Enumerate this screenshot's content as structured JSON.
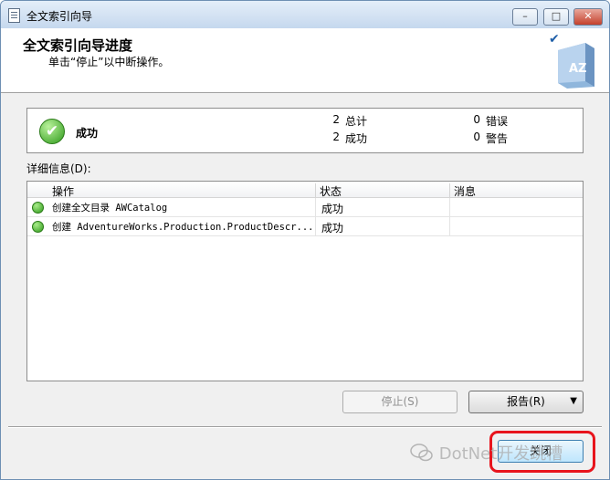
{
  "window": {
    "title": "全文索引向导",
    "controls": {
      "minimize": "–",
      "maximize": "□",
      "close": "✕"
    }
  },
  "header": {
    "title": "全文索引向导进度",
    "subtitle": "单击“停止”以中断操作。",
    "book_icon_text": "AZ",
    "check_mark": "✔"
  },
  "status": {
    "result": "成功",
    "icon_glyph": "✔",
    "total_count": "2",
    "total_label": "总计",
    "success_count": "2",
    "success_label": "成功",
    "error_count": "0",
    "error_label": "错误",
    "warning_count": "0",
    "warning_label": "警告"
  },
  "details": {
    "label": "详细信息(D):",
    "columns": [
      "操作",
      "状态",
      "消息"
    ],
    "rows": [
      {
        "operation": "创建全文目录 AWCatalog",
        "status": "成功",
        "message": ""
      },
      {
        "operation": "创建 AdventureWorks.Production.ProductDescr...",
        "status": "成功",
        "message": ""
      }
    ]
  },
  "buttons": {
    "stop": "停止(S)",
    "report": "报告(R)",
    "report_arrow": "▼",
    "close": "关闭"
  },
  "watermark": "DotNet开发跳槽",
  "colors": {
    "highlight": "#e8141c",
    "success": "#2f9a1b"
  }
}
